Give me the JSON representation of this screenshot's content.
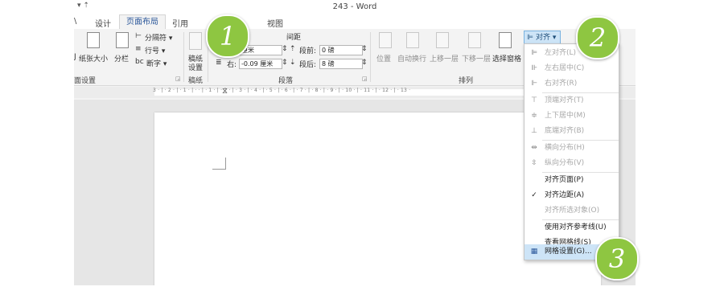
{
  "window": {
    "title": "243 - Word",
    "qat": "▾ ⇡"
  },
  "tabs": {
    "home_fragment": "\\",
    "design": "设计",
    "layout": "页面布局",
    "references": "引用",
    "view": "视图"
  },
  "ribbon": {
    "page_setup": {
      "size": "纸张大小",
      "margins_frag": "J",
      "columns": "分栏",
      "breaks": "分隔符 ▾",
      "line_numbers": "行号 ▾",
      "hyphenation": "断字 ▾",
      "group_label": "面设置"
    },
    "draft": {
      "line1": "稿纸",
      "line2": "设置",
      "group_label": "稿纸"
    },
    "paragraph": {
      "spacing_header": "间距",
      "indent_left_value": "厘米",
      "indent_right_label": "右:",
      "indent_right_value": "-0.09 厘米",
      "before_label": "段前:",
      "before_value": "0 磅",
      "after_label": "段后:",
      "after_value": "8 磅",
      "group_label": "段落"
    },
    "arrange": {
      "position": "位置",
      "wrap_text": "自动换行",
      "bring_forward": "上移一层",
      "send_backward": "下移一层",
      "selection_pane": "选择窗格",
      "group_label": "排列"
    },
    "align_button": "对齐 ▾"
  },
  "ruler": {
    "ticks": "3 · | · 2 · | · 1 · | ·   · | · 1 · | · 2 · | · 3 · | · 4 · | · 5 · | · 6 · | · 7 · | · 8 · | · 9 · | · 10 · | · 11 · | · 12 · | · 13 ·"
  },
  "align_menu": {
    "items": [
      {
        "label": "左对齐(L)",
        "enabled": false,
        "icon": "align-left-icon"
      },
      {
        "label": "左右居中(C)",
        "enabled": false,
        "icon": "align-center-icon"
      },
      {
        "label": "右对齐(R)",
        "enabled": false,
        "icon": "align-right-icon"
      },
      {
        "label": "顶端对齐(T)",
        "enabled": false,
        "icon": "align-top-icon"
      },
      {
        "label": "上下居中(M)",
        "enabled": false,
        "icon": "align-middle-icon"
      },
      {
        "label": "底端对齐(B)",
        "enabled": false,
        "icon": "align-bottom-icon"
      },
      {
        "label": "横向分布(H)",
        "enabled": false,
        "icon": "distribute-horizontal-icon"
      },
      {
        "label": "纵向分布(V)",
        "enabled": false,
        "icon": "distribute-vertical-icon"
      },
      {
        "label": "对齐页面(P)",
        "enabled": true
      },
      {
        "label": "对齐边距(A)",
        "enabled": true,
        "checked": true
      },
      {
        "label": "对齐所选对象(O)",
        "enabled": false
      },
      {
        "label": "使用对齐参考线(U)",
        "enabled": true
      },
      {
        "label": "查看网格线(S)",
        "enabled": true
      },
      {
        "label": "网格设置(G)...",
        "enabled": true,
        "highlighted": true,
        "icon": "grid-icon"
      }
    ],
    "check_mark": "✓"
  },
  "callouts": [
    "1",
    "2",
    "3"
  ],
  "colors": {
    "callout_green": "#8ec641",
    "menu_highlight": "#cde4f7",
    "active_tab_text": "#2b579a"
  }
}
